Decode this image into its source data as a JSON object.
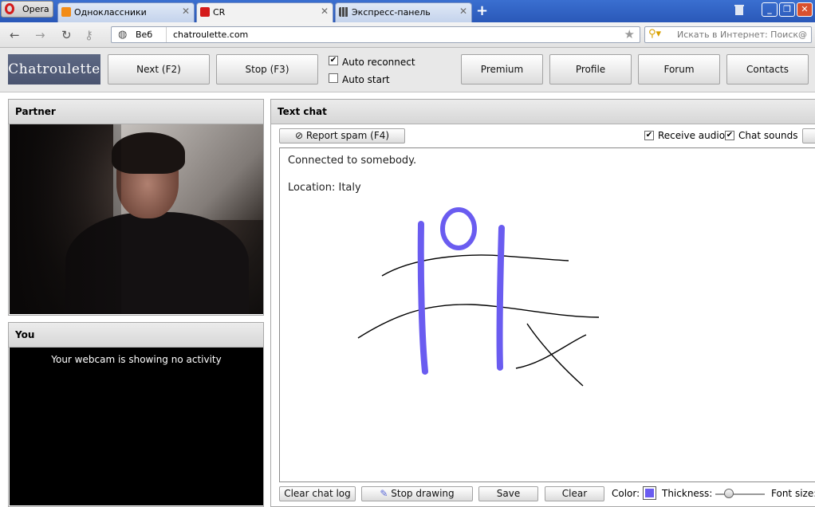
{
  "browser": {
    "menu_label": "Opera",
    "tabs": [
      {
        "label": "Одноклассники",
        "active": false,
        "icon_color": "#f28c18"
      },
      {
        "label": "CR",
        "active": true,
        "icon_color": "#d41b1b"
      },
      {
        "label": "Экспресс-панель",
        "active": false,
        "icon_color": "#4a4a4a"
      }
    ],
    "address": {
      "zone_label": "Веб",
      "url": "chatroulette.com"
    },
    "search": {
      "placeholder": "Искать в Интернет: Поиск@"
    }
  },
  "site": {
    "logo": "Chatroulette",
    "buttons": {
      "next": "Next (F2)",
      "stop": "Stop (F3)",
      "premium": "Premium",
      "profile": "Profile",
      "forum": "Forum",
      "contacts": "Contacts"
    },
    "options": {
      "auto_reconnect": {
        "label": "Auto reconnect",
        "checked": true
      },
      "auto_start": {
        "label": "Auto start",
        "checked": false
      }
    }
  },
  "partner_panel": {
    "title": "Partner"
  },
  "you_panel": {
    "title": "You",
    "message": "Your webcam is showing no activity"
  },
  "chat": {
    "title": "Text chat",
    "report_spam": "Report spam (F4)",
    "receive_audio": {
      "label": "Receive audio",
      "checked": true
    },
    "chat_sounds": {
      "label": "Chat sounds",
      "checked": true
    },
    "messages": [
      "Connected to somebody.",
      "Location: Italy"
    ],
    "toolbar": {
      "clear_log": "Clear chat log",
      "stop_drawing": "Stop drawing",
      "save": "Save",
      "clear": "Clear",
      "color_label": "Color:",
      "thickness_label": "Thickness:",
      "font_size_label": "Font size:"
    },
    "pen_color": "#6a5cf0",
    "thickness": 0.27
  }
}
